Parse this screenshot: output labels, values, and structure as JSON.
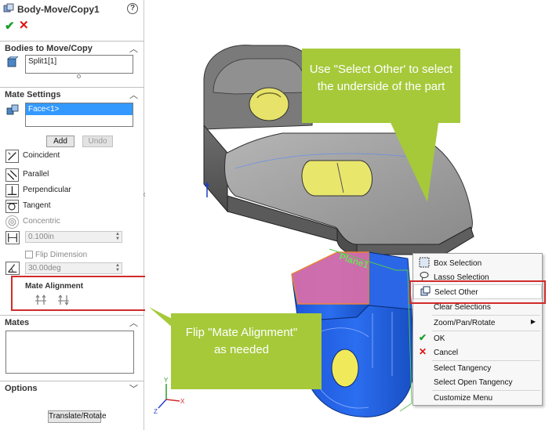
{
  "panel": {
    "title": "Body-Move/Copy1",
    "help": "?",
    "ok_symbol": "✔",
    "cancel_symbol": "✕",
    "bodies_section": {
      "label": "Bodies to Move/Copy",
      "items": [
        "Split1[1]"
      ]
    },
    "mate_settings": {
      "label": "Mate Settings",
      "items": [
        "Face<1>"
      ],
      "add_label": "Add",
      "undo_label": "Undo",
      "mates": [
        {
          "label": "Coincident",
          "enabled": true
        },
        {
          "label": "Parallel",
          "enabled": true
        },
        {
          "label": "Perpendicular",
          "enabled": true
        },
        {
          "label": "Tangent",
          "enabled": true
        },
        {
          "label": "Concentric",
          "enabled": false
        }
      ],
      "distance_value": "0.100in",
      "flip_dimension_label": "Flip Dimension",
      "angle_value": "30.00deg",
      "mate_alignment_label": "Mate Alignment"
    },
    "mates_section": {
      "label": "Mates"
    },
    "options_section": {
      "label": "Options"
    },
    "translate_rotate_label": "Translate/Rotate"
  },
  "viewport": {
    "callout_top": "Use \"Select Other' to select the underside of the part",
    "callout_bottom": "Flip \"Mate Alignment\" as needed",
    "plane_label": "Plane1"
  },
  "context_menu": {
    "items": [
      {
        "label": "Box Selection",
        "icon": "box-select-icon"
      },
      {
        "label": "Lasso Selection",
        "icon": "lasso-icon"
      },
      {
        "label": "Select Other",
        "icon": "select-other-icon"
      },
      {
        "label": "Clear Selections",
        "icon": ""
      },
      {
        "label": "Zoom/Pan/Rotate",
        "icon": "submenu-arrow"
      },
      {
        "label": "OK",
        "icon": "check-icon"
      },
      {
        "label": "Cancel",
        "icon": "x-icon"
      },
      {
        "label": "Select Tangency",
        "icon": ""
      },
      {
        "label": "Select Open Tangency",
        "icon": ""
      },
      {
        "label": "Customize Menu",
        "icon": ""
      }
    ]
  },
  "colors": {
    "callout_green": "#a6c93a",
    "highlight_red": "#d12b2b",
    "selection_blue": "#3399ff",
    "part_gray": "#8c8c8c",
    "part_blue": "#1f5fe0"
  }
}
